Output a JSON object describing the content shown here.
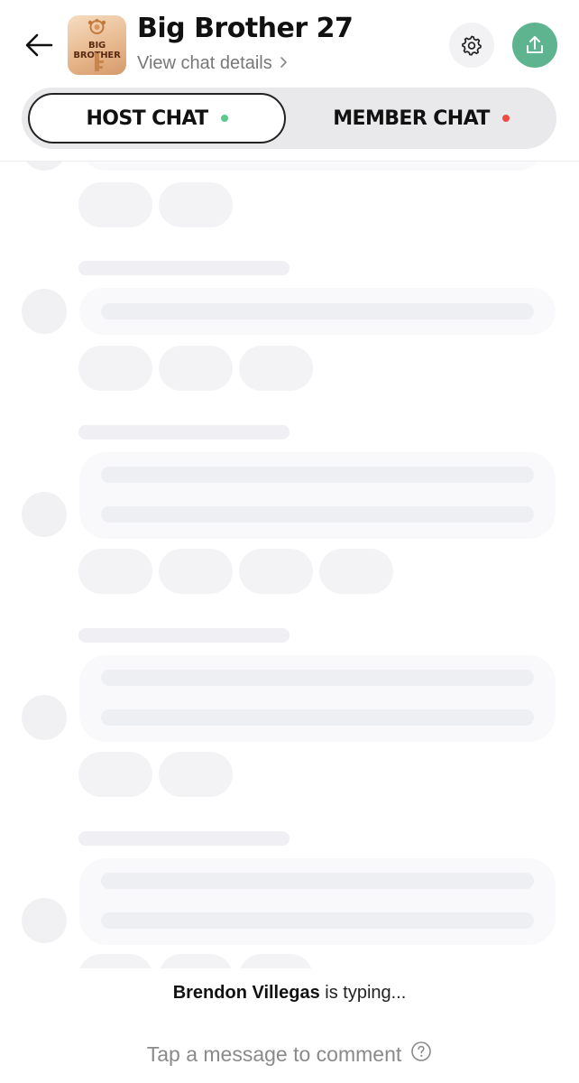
{
  "header": {
    "title": "Big Brother 27",
    "subtitle": "View chat details",
    "avatar_text": "BIG BROTHER",
    "back_icon": "arrow-left-icon",
    "settings_icon": "gear-icon",
    "share_icon": "share-upload-icon"
  },
  "tabs": [
    {
      "label": "HOST CHAT",
      "active": true,
      "status_color": "#5cc98a"
    },
    {
      "label": "MEMBER CHAT",
      "active": false,
      "status_color": "#ef4b43"
    }
  ],
  "typing": {
    "name": "Brendon Villegas",
    "suffix": " is typing..."
  },
  "composer": {
    "placeholder": "Tap a message to comment",
    "help_icon": "question-circle-icon"
  },
  "colors": {
    "accent_green": "#5db48f",
    "skeleton": "#f3f3f6"
  }
}
